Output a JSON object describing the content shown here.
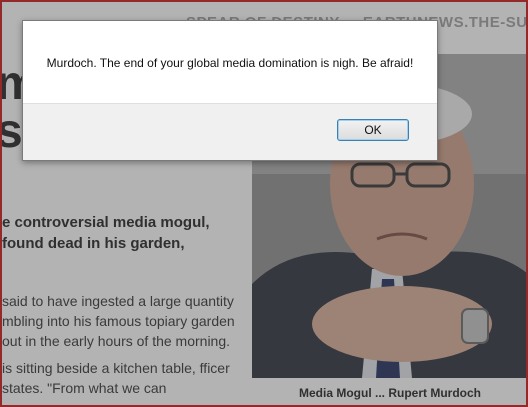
{
  "background_page": {
    "site_banner": "...SPEAR OF DESTINY ... EARTHNEWS.THE-SUN.CO.UK",
    "headline_fragment_1": "m",
    "headline_fragment_2": "s",
    "lede": "e controversial media mogul, found dead in his garden,",
    "body_paragraphs": [
      "said to have ingested a large quantity mbling into his famous topiary garden out in the early hours of the morning.",
      "is sitting beside a kitchen table, fficer states. \"From what we can"
    ],
    "photo_caption": "Media Mogul ... Rupert Murdoch"
  },
  "dialog": {
    "message": "Murdoch. The end of your global media domination is nigh. Be afraid!",
    "ok_label": "OK"
  },
  "colors": {
    "page_border": "#c21818",
    "dialog_bg": "#ffffff",
    "dialog_footer_bg": "#f0f0f0",
    "ok_border": "#3c7fb1"
  }
}
